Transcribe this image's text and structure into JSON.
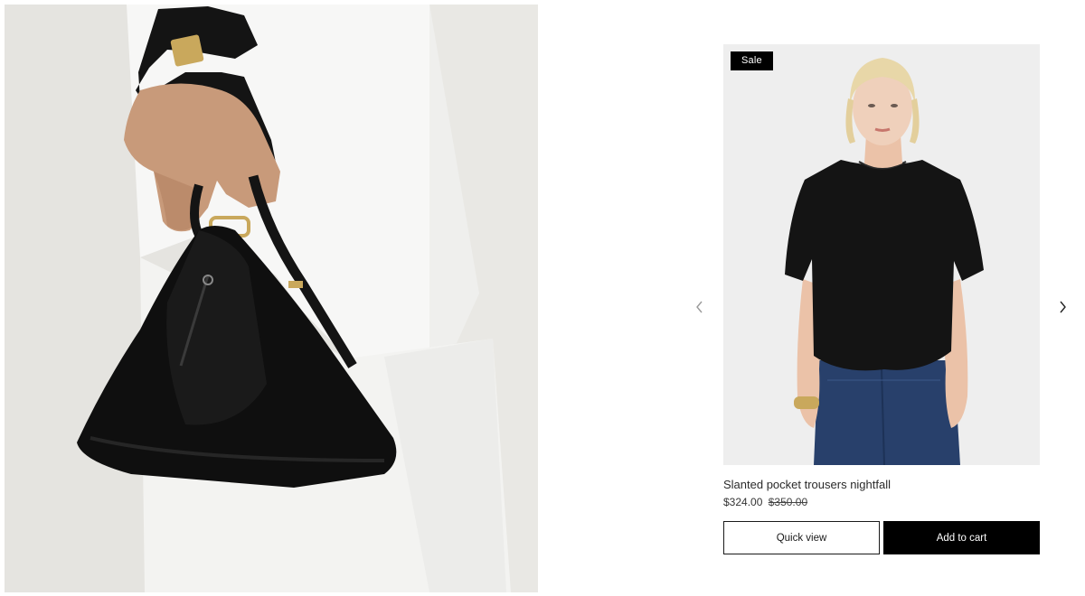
{
  "hero": {
    "image": "woman-holding-black-leather-triangle-bag",
    "icon": "lifestyle-photo"
  },
  "carousel": {
    "prev_icon": "chevron-left-icon",
    "next_icon": "chevron-right-icon"
  },
  "product": {
    "badge": "Sale",
    "image": "model-wearing-black-tshirt-and-jeans",
    "name": "Slanted pocket trousers nightfall",
    "price_current": "$324.00",
    "price_original": "$350.00"
  },
  "actions": {
    "quick_view": "Quick view",
    "add_to_cart": "Add to cart"
  },
  "colors": {
    "badge_bg": "#000000",
    "button_solid": "#000000",
    "button_outline_border": "#1a1a1a"
  }
}
